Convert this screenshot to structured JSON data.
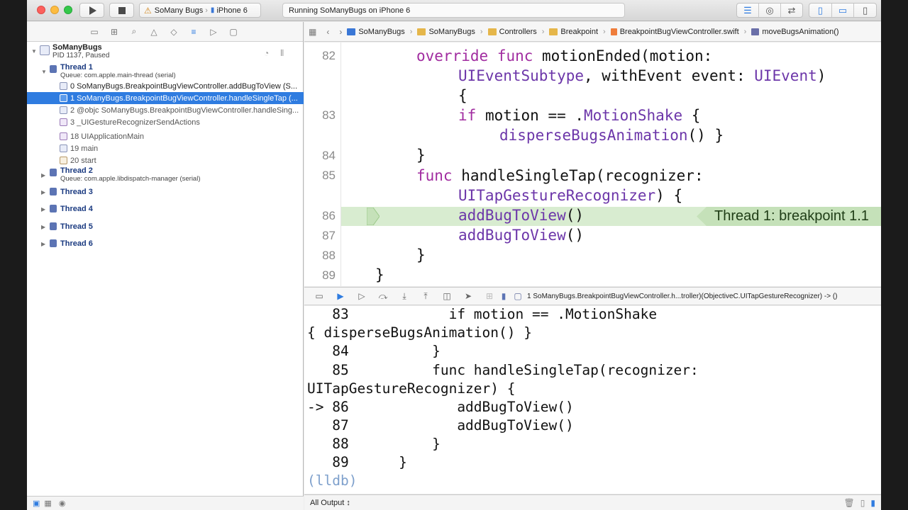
{
  "toolbar": {
    "scheme_project": "SoMany Bugs",
    "scheme_device": "iPhone 6",
    "activity": "Running SoManyBugs on iPhone 6"
  },
  "navigator": {
    "process_name": "SoManyBugs",
    "process_status": "PID 1137, Paused",
    "thread1": {
      "title": "Thread 1",
      "queue": "Queue: com.apple.main-thread (serial)"
    },
    "frames": [
      "0 SoManyBugs.BreakpointBugViewController.addBugToView (S...",
      "1 SoManyBugs.BreakpointBugViewController.handleSingleTap (...",
      "2 @objc SoManyBugs.BreakpointBugViewController.handleSing...",
      "3 _UIGestureRecognizerSendActions",
      "18 UIApplicationMain",
      "19 main",
      "20 start"
    ],
    "thread2": {
      "title": "Thread 2",
      "queue": "Queue: com.apple.libdispatch-manager (serial)"
    },
    "other_threads": [
      "Thread 3",
      "Thread 4",
      "Thread 5",
      "Thread 6"
    ]
  },
  "jumpbar": {
    "crumbs": [
      "SoManyBugs",
      "SoManyBugs",
      "Controllers",
      "Breakpoint",
      "BreakpointBugViewController.swift",
      "moveBugsAnimation()"
    ]
  },
  "editor": {
    "line_numbers": [
      "82",
      "83",
      "84",
      "85",
      "86",
      "87",
      "88",
      "89"
    ],
    "breakpoint_label": "Thread 1: breakpoint 1.1"
  },
  "debugbar": {
    "frame": "1 SoManyBugs.BreakpointBugViewController.h...troller)(ObjectiveC.UITapGestureRecognizer) -> ()"
  },
  "console": {
    "lines": [
      "   83            if motion == .MotionShake",
      "{ disperseBugsAnimation() }",
      "   84          }",
      "   85          func handleSingleTap(recognizer:",
      "UITapGestureRecognizer) {",
      "-> 86             addBugToView()",
      "   87             addBugToView()",
      "   88          }",
      "   89      }"
    ],
    "prompt": "(lldb)",
    "output_selector": "All Output ↕"
  },
  "colors": {
    "accent": "#2f7ce0",
    "keyword": "#a12ca0",
    "type": "#6c36a9",
    "breakpoint_highlight": "#d8ecd0"
  }
}
